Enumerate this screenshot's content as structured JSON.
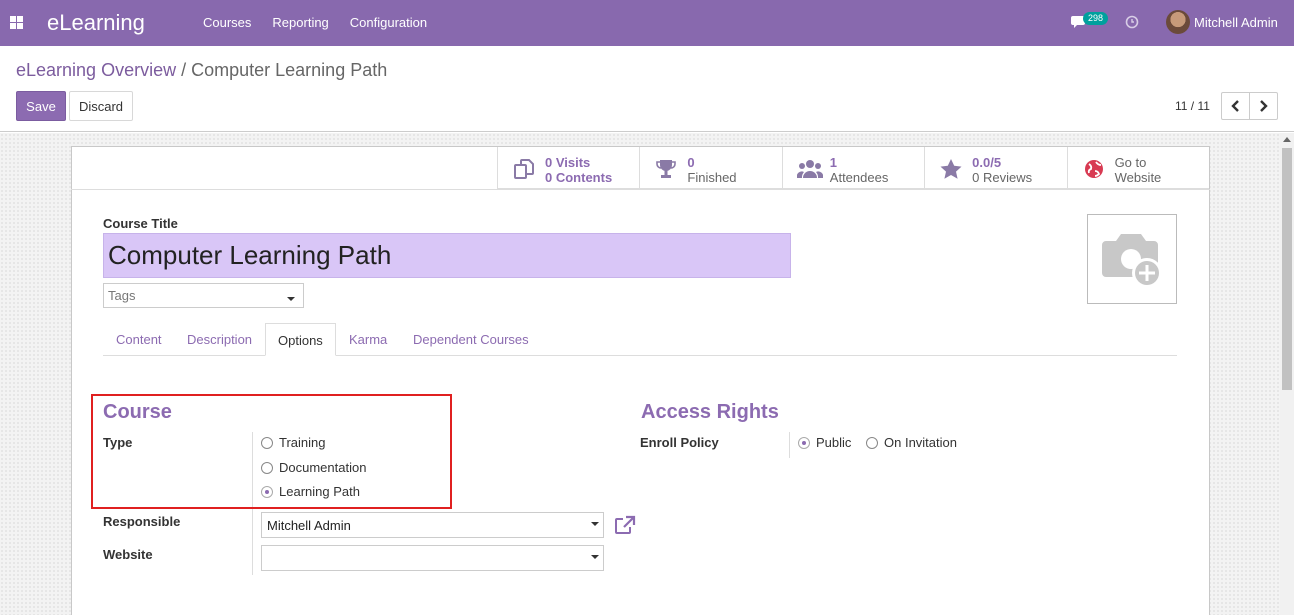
{
  "navbar": {
    "app_name": "eLearning",
    "menu": [
      "Courses",
      "Reporting",
      "Configuration"
    ],
    "message_count": "298",
    "user_name": "Mitchell Admin",
    "color": "#8869ae"
  },
  "breadcrumb": {
    "parent": "eLearning Overview",
    "separator": "/",
    "current": "Computer Learning Path"
  },
  "actions": {
    "save_label": "Save",
    "discard_label": "Discard"
  },
  "pager": {
    "value": "11 / 11"
  },
  "stats": [
    {
      "icon": "copy-icon",
      "value": "0 Visits",
      "label": "0 Contents",
      "style": "purple"
    },
    {
      "icon": "trophy-icon",
      "value": "0",
      "label": "Finished",
      "style": "plain"
    },
    {
      "icon": "users-icon",
      "value": "1",
      "label": "Attendees",
      "style": "plain"
    },
    {
      "icon": "star-icon",
      "value": "0.0/5",
      "label": "0 Reviews",
      "style": "plain"
    },
    {
      "icon": "globe-icon",
      "value": "Go to",
      "label": "Website",
      "style": "plain"
    }
  ],
  "form": {
    "course_title_label": "Course Title",
    "course_title": "Computer Learning Path",
    "tags_placeholder": "Tags"
  },
  "tabs": [
    "Content",
    "Description",
    "Options",
    "Karma",
    "Dependent Courses"
  ],
  "active_tab": "Options",
  "course_group": {
    "title": "Course",
    "type_label": "Type",
    "type_options": [
      "Training",
      "Documentation",
      "Learning Path"
    ],
    "type_selected": "Learning Path",
    "responsible_label": "Responsible",
    "responsible_value": "Mitchell Admin",
    "website_label": "Website",
    "website_value": ""
  },
  "access_group": {
    "title": "Access Rights",
    "enroll_label": "Enroll Policy",
    "enroll_options": [
      "Public",
      "On Invitation"
    ],
    "enroll_selected": "Public"
  },
  "colors": {
    "accent": "#8c6bb1",
    "highlight": "#e02020"
  }
}
